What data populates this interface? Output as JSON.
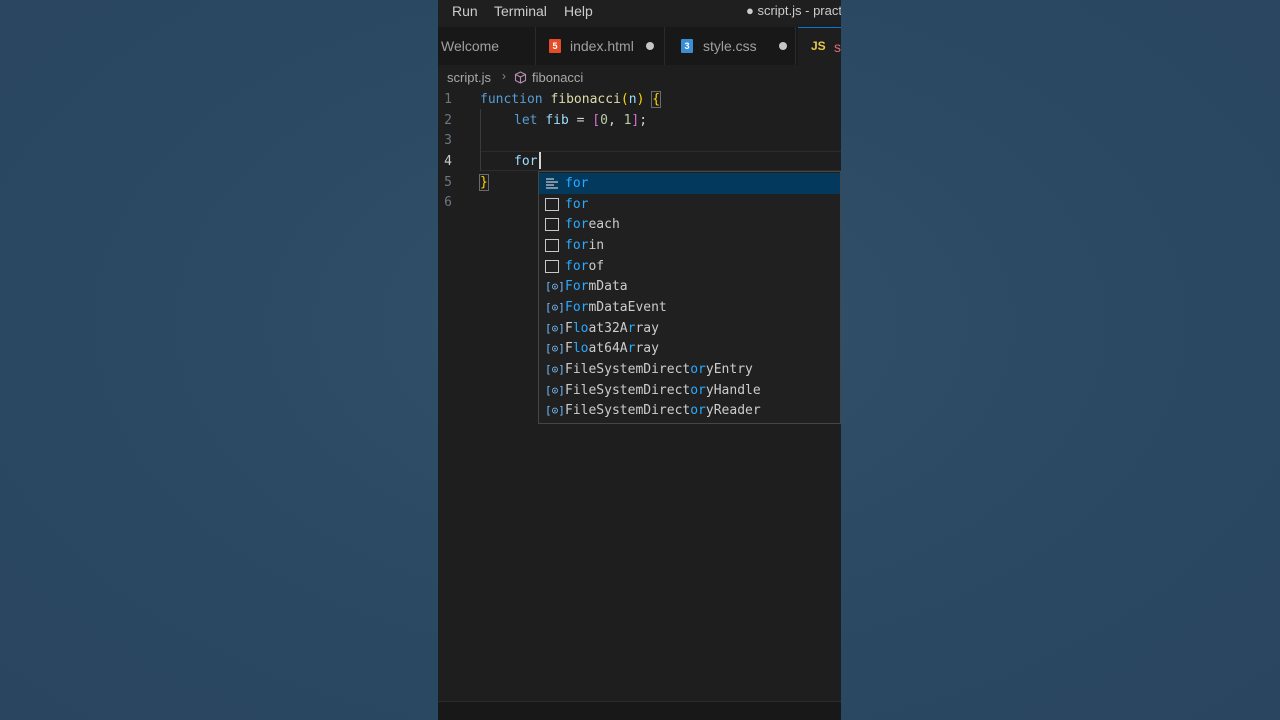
{
  "menubar": {
    "items": [
      "Run",
      "Terminal",
      "Help"
    ],
    "title": "● script.js - pract"
  },
  "tabs": [
    {
      "label": "Welcome",
      "modified": false
    },
    {
      "label": "index.html",
      "modified": true,
      "icon": "html5-icon"
    },
    {
      "label": "style.css",
      "modified": true,
      "icon": "css3-icon"
    },
    {
      "label": "s",
      "icon_text": "JS",
      "icon": "js-file-icon",
      "active": true
    }
  ],
  "breadcrumb": {
    "file": "script.js",
    "separator": "›",
    "symbol": "fibonacci",
    "symbol_icon": "cube-icon"
  },
  "editor": {
    "line_numbers": [
      "1",
      "2",
      "3",
      "4",
      "5",
      "6"
    ],
    "current_line": "4",
    "line1": {
      "kw": "function",
      "name": "fibonacci",
      "paren_open": "(",
      "param": "n",
      "paren_close": ")",
      "brace": "{"
    },
    "line2": {
      "kw": "let",
      "var": "fib",
      "eq": "=",
      "arr_open": "[",
      "v0": "0",
      "comma": ",",
      "v1": "1",
      "arr_close": "]",
      "semi": ";"
    },
    "line4": {
      "typed": "for"
    },
    "line5": {
      "brace": "}"
    }
  },
  "suggestions": [
    {
      "match": "for",
      "rest": "",
      "icon": "snippet-lines-icon",
      "selected": true
    },
    {
      "match": "for",
      "rest": "",
      "icon": "snippet-square-icon"
    },
    {
      "match": "for",
      "rest": "each",
      "icon": "snippet-square-icon"
    },
    {
      "match": "for",
      "rest": "in",
      "icon": "snippet-square-icon"
    },
    {
      "match": "for",
      "rest": "of",
      "icon": "snippet-square-icon"
    },
    {
      "match": "For",
      "rest": "mData",
      "icon": "variable-icon"
    },
    {
      "match": "For",
      "rest": "mDataEvent",
      "icon": "variable-icon"
    },
    {
      "pre": "F",
      "match": "lo",
      "mid": "at32A",
      "match2": "r",
      "rest": "ray",
      "icon": "variable-icon"
    },
    {
      "pre": "F",
      "match": "lo",
      "mid": "at64A",
      "match2": "r",
      "rest": "ray",
      "icon": "variable-icon"
    },
    {
      "pre": "FileSystemDirect",
      "match": "or",
      "rest": "yEntry",
      "icon": "variable-icon"
    },
    {
      "pre": "FileSystemDirect",
      "match": "or",
      "rest": "yHandle",
      "icon": "variable-icon"
    },
    {
      "pre": "FileSystemDirect",
      "match": "or",
      "rest": "yReader",
      "icon": "variable-icon"
    }
  ]
}
